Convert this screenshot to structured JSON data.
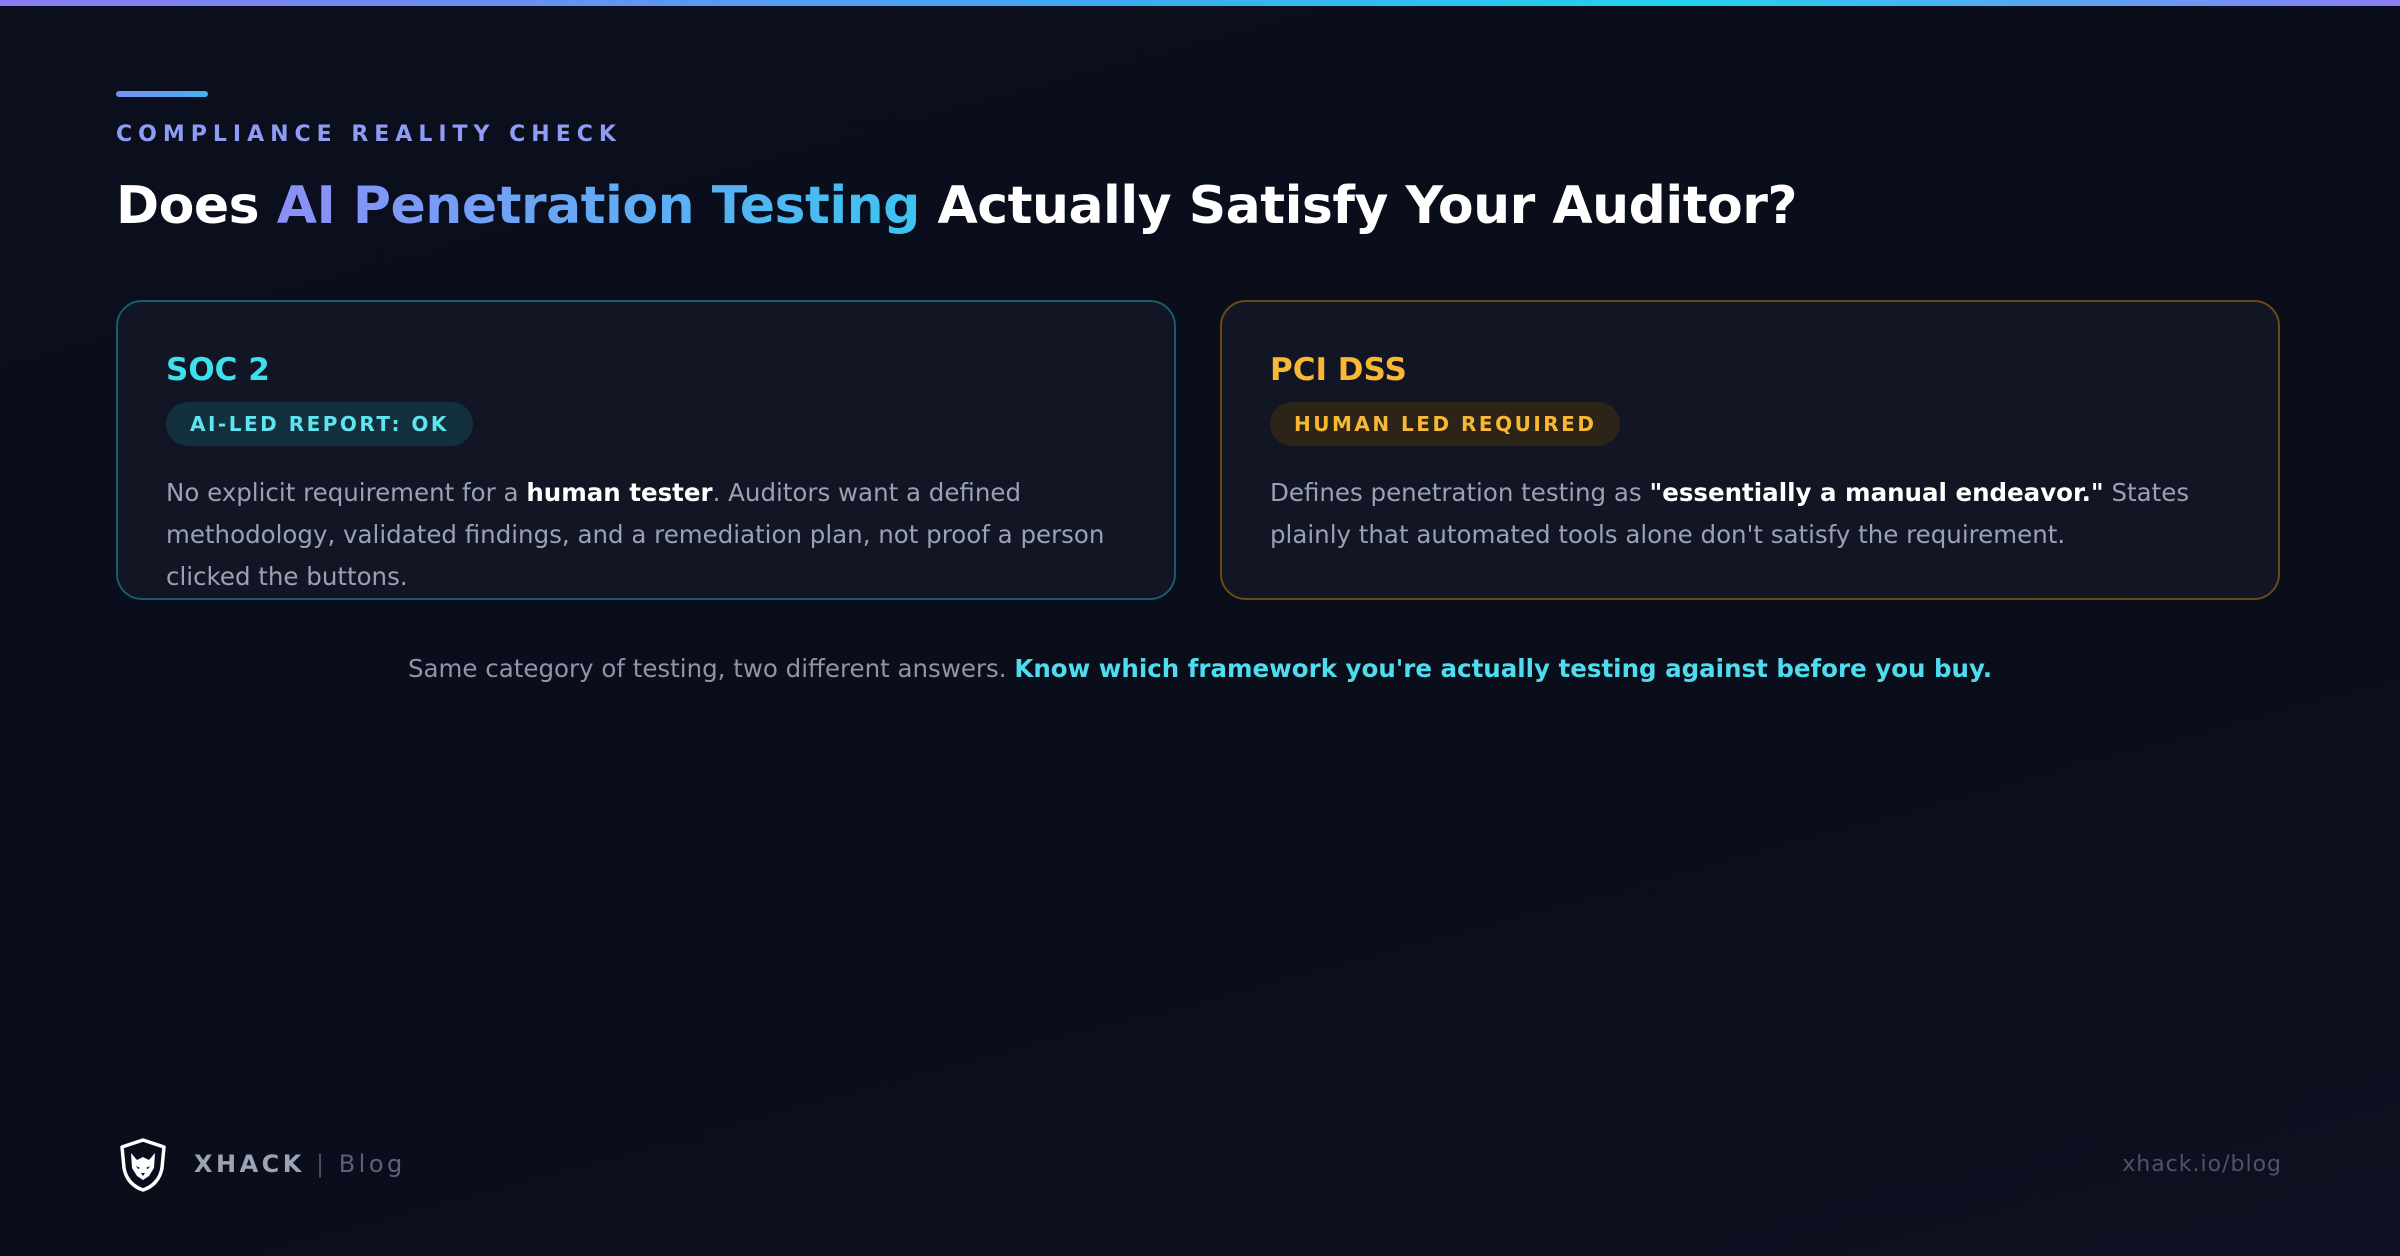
{
  "header": {
    "eyebrow": "COMPLIANCE REALITY CHECK",
    "title_prefix": "Does ",
    "title_highlight": "AI Penetration Testing",
    "title_suffix": " Actually Satisfy Your Auditor?"
  },
  "cards": [
    {
      "title": "SOC 2",
      "badge": "AI-LED REPORT: OK",
      "body_1": "No explicit requirement for a ",
      "body_bold": "human tester",
      "body_2": ". Auditors want a defined methodology, validated findings, and a remediation plan, not proof a person clicked the buttons.",
      "accent_color": "#3fe0ee"
    },
    {
      "title": "PCI DSS",
      "badge": "HUMAN LED REQUIRED",
      "body_1": "Defines penetration testing as ",
      "body_bold": "\"essentially a manual endeavor.\"",
      "body_2": " States plainly that automated tools alone don't satisfy the requirement.",
      "accent_color": "#f8b833"
    }
  ],
  "summary": {
    "text": "Same category of testing, two different answers. ",
    "highlight": "Know which framework you're actually testing against before you buy."
  },
  "footer": {
    "logo_icon": "wolf-shield-icon",
    "brand": "XHACK",
    "separator": " | ",
    "section": "Blog",
    "url": "xhack.io/blog"
  }
}
